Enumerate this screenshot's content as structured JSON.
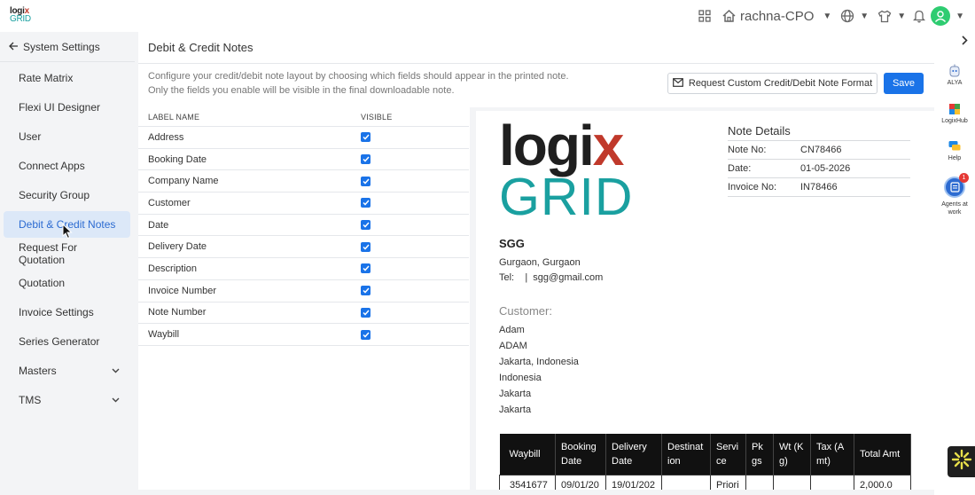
{
  "topbar": {
    "logo_line1": "logix",
    "logo_line2": "GRID",
    "user_name": "rachna-CPO"
  },
  "sidebar": {
    "back_label": "System Settings",
    "items": [
      {
        "label": "Rate Matrix"
      },
      {
        "label": "Flexi UI Designer"
      },
      {
        "label": "User"
      },
      {
        "label": "Connect Apps"
      },
      {
        "label": "Security Group"
      },
      {
        "label": "Debit & Credit Notes",
        "active": true
      },
      {
        "label": "Request For Quotation"
      },
      {
        "label": "Quotation"
      },
      {
        "label": "Invoice Settings"
      },
      {
        "label": "Series Generator"
      },
      {
        "label": "Masters",
        "expandable": true
      },
      {
        "label": "TMS",
        "expandable": true
      }
    ]
  },
  "main": {
    "title": "Debit & Credit Notes",
    "description": "Configure your credit/debit note layout by choosing which fields should appear in the printed note. Only the fields you enable will be visible in the final downloadable note.",
    "request_button": "Request Custom Credit/Debit Note Format",
    "save_button": "Save",
    "table_headers": {
      "label": "LABEL NAME",
      "visible": "VISIBLE"
    },
    "fields": [
      {
        "label": "Address",
        "visible": true
      },
      {
        "label": "Booking Date",
        "visible": true
      },
      {
        "label": "Company Name",
        "visible": true
      },
      {
        "label": "Customer",
        "visible": true
      },
      {
        "label": "Date",
        "visible": true
      },
      {
        "label": "Delivery Date",
        "visible": true
      },
      {
        "label": "Description",
        "visible": true
      },
      {
        "label": "Invoice Number",
        "visible": true
      },
      {
        "label": "Note Number",
        "visible": true
      },
      {
        "label": "Waybill",
        "visible": true
      }
    ]
  },
  "preview": {
    "logo_top": "logix",
    "logo_bottom": "GRID",
    "note_details_title": "Note Details",
    "note_details": [
      {
        "key": "Note No:",
        "value": "CN78466"
      },
      {
        "key": "Date:",
        "value": "01-05-2026"
      },
      {
        "key": "Invoice No:",
        "value": "IN78466"
      }
    ],
    "company_name": "SGG",
    "company_address": "Gurgaon, Gurgaon",
    "company_contact": "Tel:    |  sgg@gmail.com",
    "customer_label": "Customer:",
    "customer_lines": [
      "Adam",
      "ADAM",
      "Jakarta, Indonesia",
      "Indonesia",
      "Jakarta",
      "Jakarta"
    ],
    "table_headers": [
      "Waybill",
      "Booking Date",
      "Delivery Date",
      "Destination",
      "Service",
      "Pkgs",
      "Wt (Kg)",
      "Tax (Amt)",
      "Total Amt"
    ],
    "table_row": [
      "35416777",
      "09/01/202",
      "19/01/202",
      "",
      "Priori",
      "",
      "",
      "",
      "2,000.0"
    ]
  },
  "rail": {
    "alya": "ALYA",
    "logixhub": "LogixHub",
    "help": "Help",
    "agents": "Agents at work",
    "agents_badge": "1"
  },
  "colors": {
    "accent": "#1a73e8",
    "brand_teal": "#1aa0a0",
    "active_bg": "#dce8f8"
  }
}
